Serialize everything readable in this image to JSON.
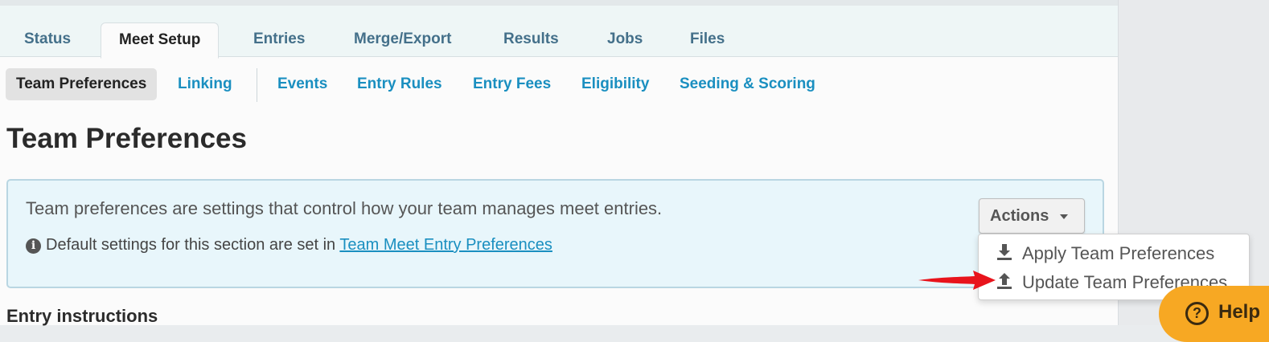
{
  "tabs": [
    {
      "label": "Status",
      "active": false
    },
    {
      "label": "Meet Setup",
      "active": true
    },
    {
      "label": "Entries",
      "active": false
    },
    {
      "label": "Merge/Export",
      "active": false
    },
    {
      "label": "Results",
      "active": false
    },
    {
      "label": "Jobs",
      "active": false
    },
    {
      "label": "Files",
      "active": false
    }
  ],
  "subnav": [
    {
      "label": "Team Preferences",
      "active": true
    },
    {
      "label": "Linking",
      "active": false
    },
    {
      "label": "Events",
      "active": false
    },
    {
      "label": "Entry Rules",
      "active": false
    },
    {
      "label": "Entry Fees",
      "active": false
    },
    {
      "label": "Eligibility",
      "active": false
    },
    {
      "label": "Seeding & Scoring",
      "active": false
    }
  ],
  "page_title": "Team Preferences",
  "info_box": {
    "main_text": "Team preferences are settings that control how your team manages meet entries.",
    "note_prefix": "Default settings for this section are set in ",
    "note_link": "Team Meet Entry Preferences"
  },
  "actions": {
    "label": "Actions",
    "menu": [
      {
        "label": "Apply Team Preferences",
        "icon": "download-icon"
      },
      {
        "label": "Update Team Preferences",
        "icon": "upload-icon"
      }
    ]
  },
  "section_heading": "Entry instructions",
  "help": {
    "label": "Help"
  },
  "colors": {
    "link": "#1a8fc0",
    "tab_text": "#44708a",
    "info_bg": "#e8f6fb",
    "help_bg": "#f7a823",
    "arrow": "#e8141c"
  }
}
